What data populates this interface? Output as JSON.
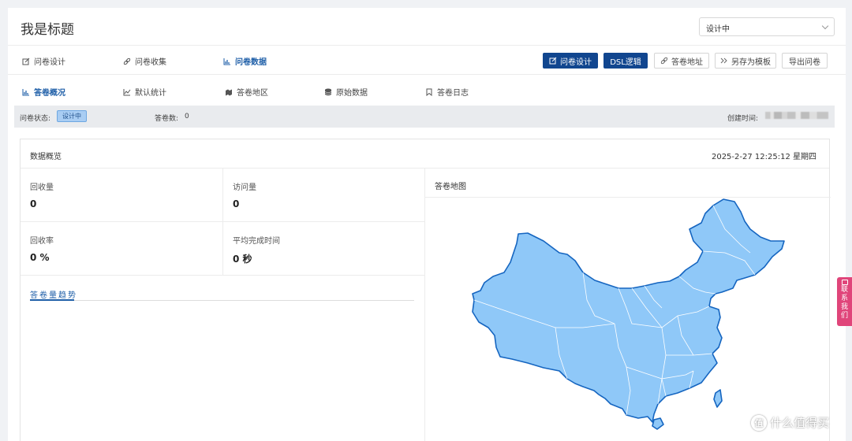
{
  "header": {
    "title": "我是标题",
    "status_value": "设计中"
  },
  "nav": {
    "items": [
      {
        "label": "问卷设计",
        "icon": "edit-icon"
      },
      {
        "label": "问卷收集",
        "icon": "link-icon"
      },
      {
        "label": "问卷数据",
        "icon": "chart-icon",
        "active": true
      }
    ],
    "buttons": [
      {
        "label": "问卷设计",
        "icon": "edit-icon",
        "primary": true
      },
      {
        "label": "DSL逻辑",
        "primary": true
      },
      {
        "label": "答卷地址",
        "icon": "link-icon"
      },
      {
        "label": "另存为模板",
        "icon": "double-chevron-icon"
      },
      {
        "label": "导出问卷"
      }
    ]
  },
  "subnav": {
    "items": [
      {
        "label": "答卷概况",
        "icon": "chart-icon",
        "active": true
      },
      {
        "label": "默认统计",
        "icon": "line-chart-icon"
      },
      {
        "label": "答卷地区",
        "icon": "map-icon"
      },
      {
        "label": "原始数据",
        "icon": "database-icon"
      },
      {
        "label": "答卷日志",
        "icon": "bookmark-icon"
      }
    ]
  },
  "info": {
    "status_label": "问卷状态:",
    "status_badge": "设计中",
    "count_label": "答卷数:",
    "count_value": "0",
    "created_label": "创建时间:"
  },
  "overview": {
    "title": "数据概览",
    "datetime": "2025-2-27 12:25:12 星期四",
    "stats": [
      {
        "label": "回收量",
        "value": "0"
      },
      {
        "label": "访问量",
        "value": "0"
      },
      {
        "label": "回收率",
        "value": "0 %"
      },
      {
        "label": "平均完成时间",
        "value": "0 秒"
      }
    ],
    "trend_tab": "答卷量趋势",
    "map_title": "答卷地图",
    "map_fill": "#8fc8f8",
    "map_stroke": "#1565c0"
  },
  "contact": {
    "label": "联系我们"
  },
  "watermark": {
    "icon_text": "值",
    "text": "什么值得买"
  },
  "colors": {
    "primary": "#11468f",
    "active_text": "#1f5fa8",
    "badge_bg": "#a9cdf3",
    "contact_bg": "#e0457a"
  }
}
